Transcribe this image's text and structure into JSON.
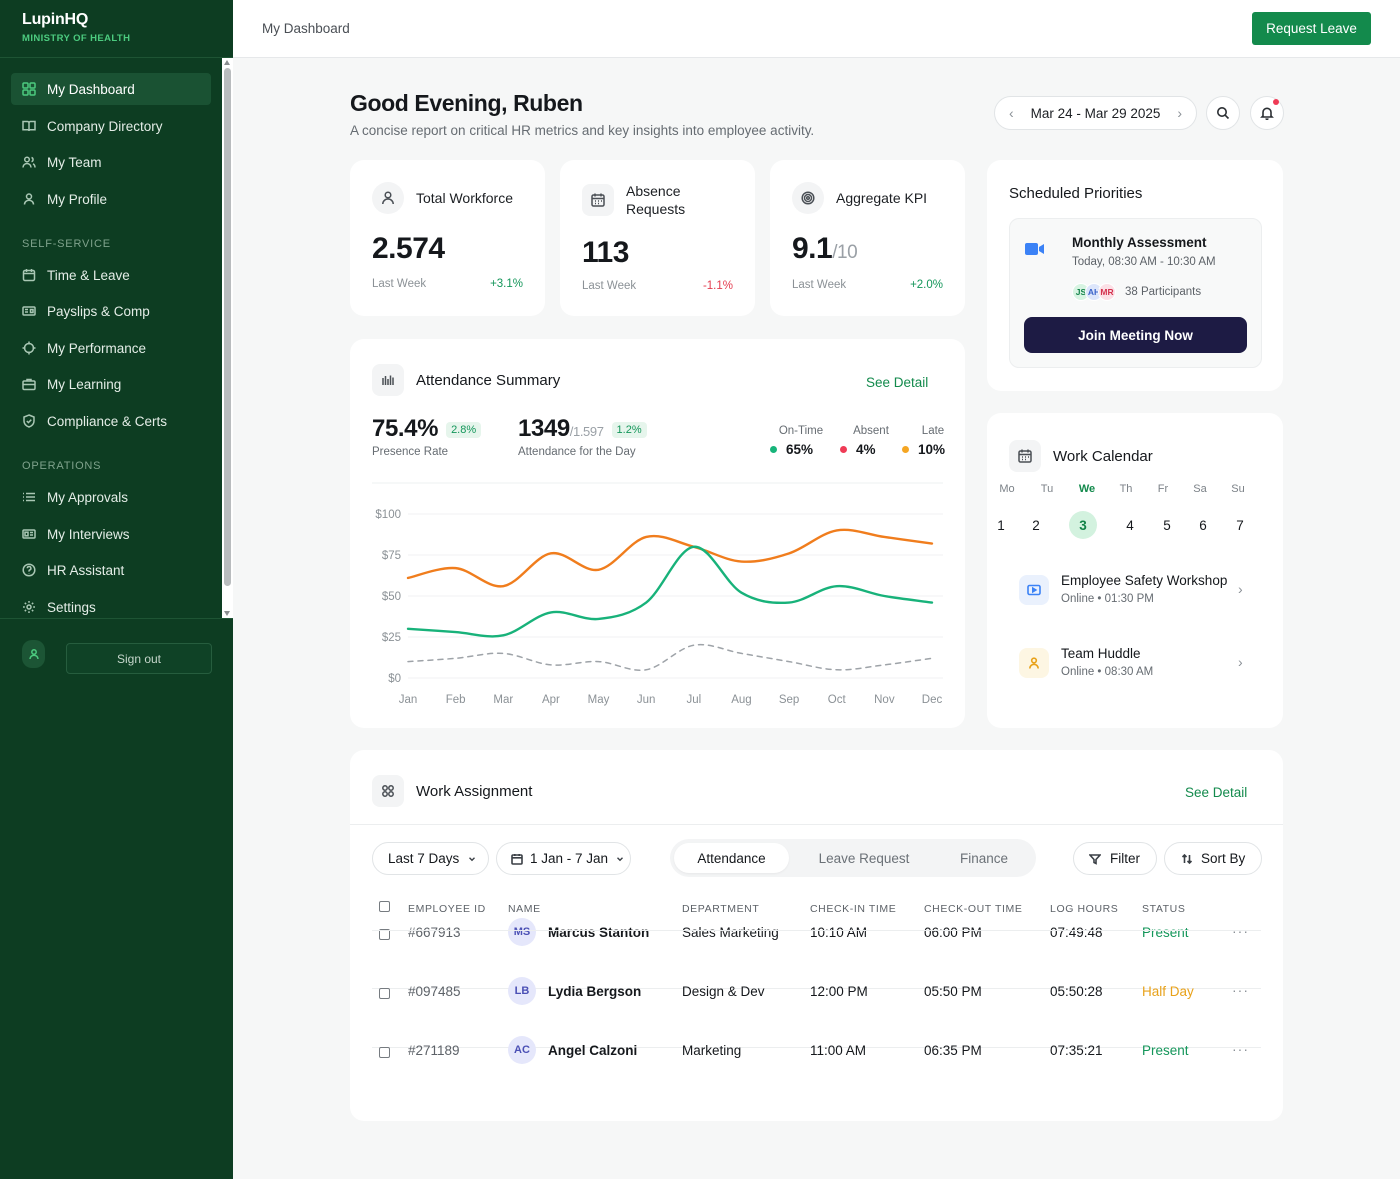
{
  "sidebar": {
    "brand": "LupinHQ",
    "org": "MINISTRY OF HEALTH",
    "main": [
      {
        "label": "My Dashboard",
        "icon": "grid-icon"
      },
      {
        "label": "Company Directory",
        "icon": "book-icon"
      },
      {
        "label": "My Team",
        "icon": "users-icon"
      },
      {
        "label": "My Profile",
        "icon": "user-icon"
      }
    ],
    "section_self_service": "SELF-SERVICE",
    "self_service": [
      {
        "label": "Time & Leave",
        "icon": "calendar-icon"
      },
      {
        "label": "Payslips & Comp",
        "icon": "wallet-icon"
      },
      {
        "label": "My Performance",
        "icon": "target-icon"
      },
      {
        "label": "My Learning",
        "icon": "briefcase-icon"
      },
      {
        "label": "Compliance & Certs",
        "icon": "shield-icon"
      }
    ],
    "section_operations": "OPERATIONS",
    "operations": [
      {
        "label": "My Approvals",
        "icon": "list-icon"
      },
      {
        "label": "My Interviews",
        "icon": "id-card-icon"
      },
      {
        "label": "HR Assistant",
        "icon": "help-icon"
      },
      {
        "label": "Settings",
        "icon": "gear-icon"
      }
    ],
    "signout": "Sign out"
  },
  "topbar": {
    "breadcrumb": "My Dashboard",
    "request_leave": "Request Leave"
  },
  "greeting": {
    "title": "Good Evening, Ruben",
    "subtitle": "A concise report on critical HR metrics and key insights into employee activity.",
    "date_range": "Mar 24 - Mar 29 2025"
  },
  "stats": {
    "workforce": {
      "label": "Total Workforce",
      "value": "2.574",
      "period": "Last Week",
      "change": "+3.1%"
    },
    "absence": {
      "label1": "Absence",
      "label2": "Requests",
      "value": "113",
      "period": "Last Week",
      "change": "-1.1%"
    },
    "kpi": {
      "label": "Aggregate KPI",
      "value": "9.1",
      "of": "/10",
      "period": "Last Week",
      "change": "+2.0%"
    }
  },
  "priorities": {
    "title": "Scheduled Priorities",
    "meeting_title": "Monthly Assessment",
    "meeting_time": "Today, 08:30 AM - 10:30 AM",
    "participants": [
      "JS",
      "AH",
      "MR"
    ],
    "participant_count": "38 Participants",
    "join": "Join Meeting Now"
  },
  "attendance": {
    "title": "Attendance Summary",
    "see_detail": "See Detail",
    "presence_value": "75.4%",
    "presence_badge": "2.8%",
    "presence_label": "Presence Rate",
    "day_value": "1349",
    "day_of": "/1.597",
    "day_badge": "1.2%",
    "day_label": "Attendance for the Day",
    "legend": [
      {
        "label": "On-Time",
        "value": "65%",
        "color": "#17b47a"
      },
      {
        "label": "Absent",
        "value": "4%",
        "color": "#ef3b56"
      },
      {
        "label": "Late",
        "value": "10%",
        "color": "#f5a623"
      }
    ]
  },
  "chart_data": {
    "type": "line",
    "categories": [
      "Jan",
      "Feb",
      "Mar",
      "Apr",
      "May",
      "Jun",
      "Jul",
      "Aug",
      "Sep",
      "Oct",
      "Nov",
      "Dec"
    ],
    "y_ticks": [
      "$100",
      "$75",
      "$50",
      "$25",
      "$0"
    ],
    "ylim": [
      0,
      100
    ],
    "series": [
      {
        "values": [
          61,
          67,
          56,
          76,
          66,
          86,
          80,
          71,
          76,
          90,
          86,
          82
        ],
        "color": "#f07d1d",
        "style": "solid"
      },
      {
        "values": [
          30,
          28,
          26,
          40,
          36,
          46,
          80,
          52,
          46,
          56,
          50,
          46
        ],
        "color": "#18b27a",
        "style": "solid"
      },
      {
        "values": [
          10,
          12,
          15,
          8,
          10,
          5,
          20,
          15,
          10,
          5,
          8,
          12
        ],
        "color": "#9ea3a8",
        "style": "dashed"
      }
    ]
  },
  "calendar": {
    "title": "Work Calendar",
    "weekdays": [
      "Mo",
      "Tu",
      "We",
      "Th",
      "Fr",
      "Sa",
      "Su"
    ],
    "days": [
      "1",
      "2",
      "3",
      "4",
      "5",
      "6",
      "7"
    ],
    "today_index": 2,
    "events": [
      {
        "title": "Employee Safety Workshop",
        "sub": "Online • 01:30 PM"
      },
      {
        "title": "Team Huddle",
        "sub": "Online • 08:30 AM"
      }
    ]
  },
  "work_assignment": {
    "title": "Work Assignment",
    "see_detail": "See Detail",
    "range": "Last 7 Days",
    "dates": "1 Jan - 7 Jan",
    "tabs": [
      "Attendance",
      "Leave Request",
      "Finance"
    ],
    "filter": "Filter",
    "sort": "Sort By",
    "columns": [
      "EMPLOYEE ID",
      "NAME",
      "DEPARTMENT",
      "CHECK-IN TIME",
      "CHECK-OUT TIME",
      "LOG HOURS",
      "STATUS"
    ],
    "rows": [
      {
        "id": "#667913",
        "initials": "MS",
        "name": "Marcus Stanton",
        "dept": "Sales Marketing",
        "in": "10:10 AM",
        "out": "06:00 PM",
        "hours": "07:49:48",
        "status": "Present",
        "status_color": "#14965a"
      },
      {
        "id": "#097485",
        "initials": "LB",
        "name": "Lydia Bergson",
        "dept": "Design & Dev",
        "in": "12:00 PM",
        "out": "05:50 PM",
        "hours": "05:50:28",
        "status": "Half Day",
        "status_color": "#e8a21b"
      },
      {
        "id": "#271189",
        "initials": "AC",
        "name": "Angel Calzoni",
        "dept": "Marketing",
        "in": "11:00 AM",
        "out": "06:35 PM",
        "hours": "07:35:21",
        "status": "Present",
        "status_color": "#14965a"
      }
    ],
    "more": "···"
  }
}
